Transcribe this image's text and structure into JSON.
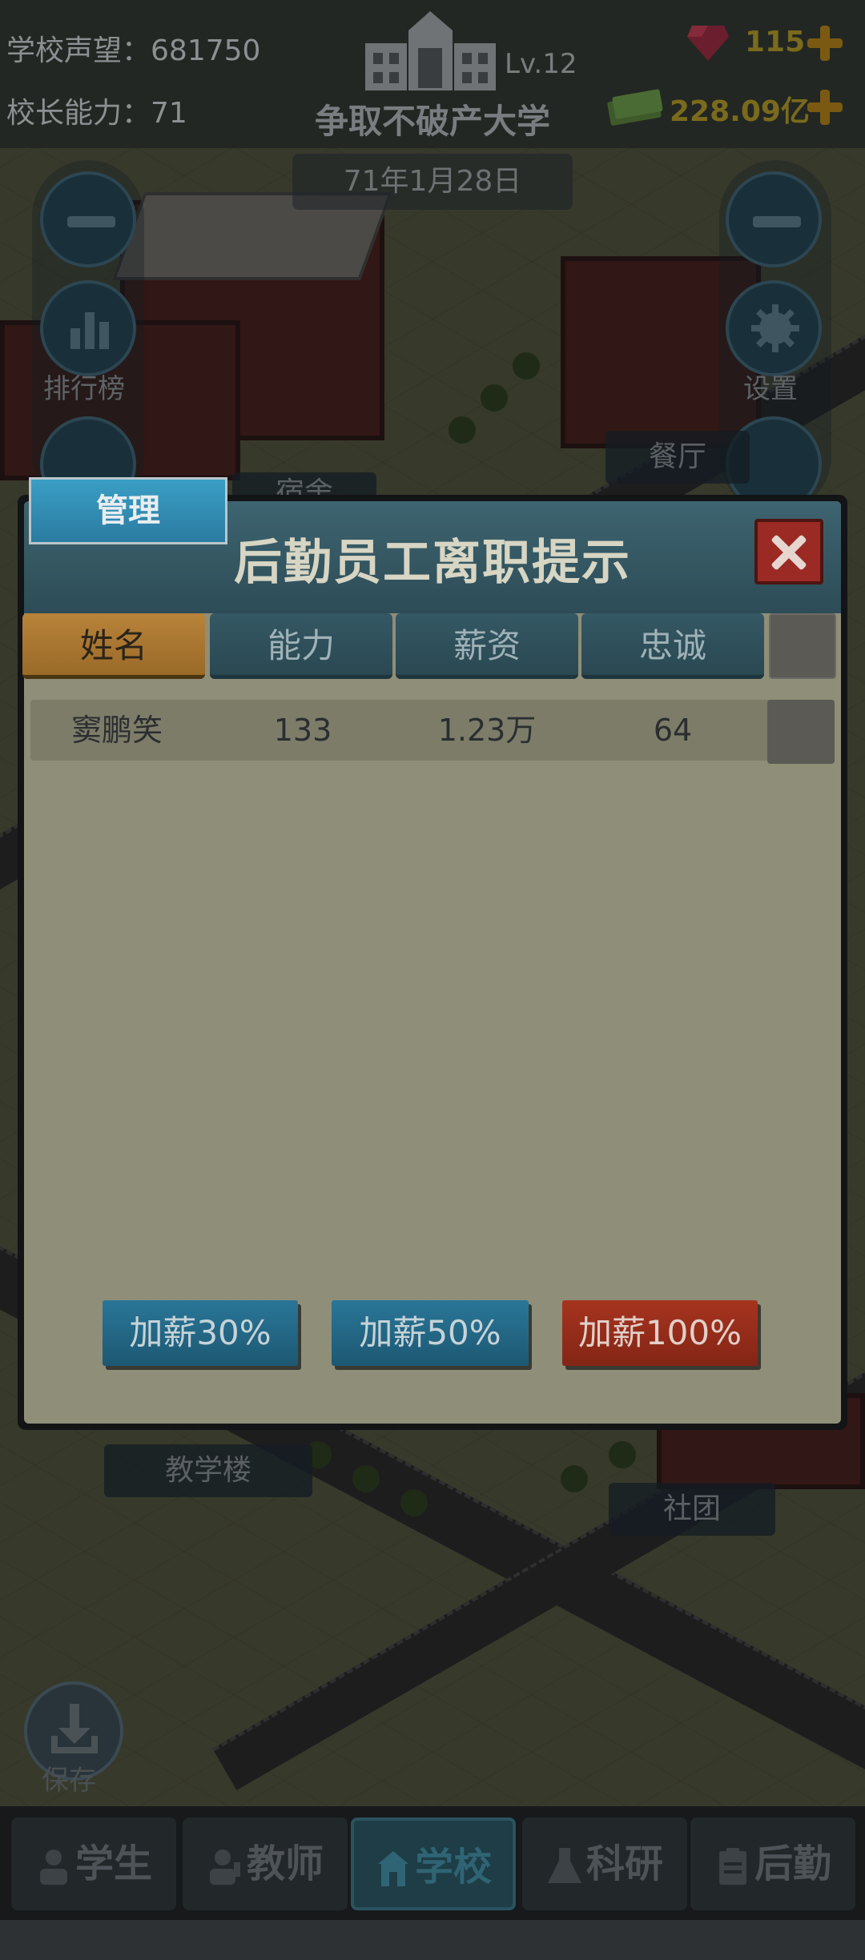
{
  "hud": {
    "reputation_label": "学校声望：",
    "reputation_value": "681750",
    "ability_label": "校长能力：",
    "ability_value": "71",
    "school_level": "Lv.12",
    "school_name": "争取不破产大学",
    "date": "71年1月28日",
    "gems": "115",
    "money": "228.09亿"
  },
  "side_buttons": {
    "ranking_label": "排行榜",
    "settings_label": "设置"
  },
  "map_tags": {
    "canteen": "餐厅",
    "dorm_partial": "宿舍",
    "teaching_building": "教学楼",
    "club": "社团"
  },
  "dialog": {
    "tab": "管理",
    "title": "后勤员工离职提示",
    "columns": [
      "姓名",
      "能力",
      "薪资",
      "忠诚"
    ],
    "rows": [
      {
        "name": "窦鹏笑",
        "ability": "133",
        "salary": "1.23万",
        "loyalty": "64"
      }
    ],
    "buttons": {
      "raise30": "加薪30%",
      "raise50": "加薪50%",
      "raise100": "加薪100%"
    }
  },
  "save_label": "保存",
  "nav": [
    {
      "label": "学生",
      "icon": "student-icon"
    },
    {
      "label": "教师",
      "icon": "teacher-icon"
    },
    {
      "label": "学校",
      "icon": "school-icon"
    },
    {
      "label": "科研",
      "icon": "flask-icon"
    },
    {
      "label": "后勤",
      "icon": "clipboard-icon"
    }
  ],
  "colors": {
    "dialog_body": "#8f8e78",
    "active_tab": "#b8833a",
    "button_blue": "#2a7698",
    "button_red": "#a6341f",
    "close_button": "#9c2a24"
  }
}
